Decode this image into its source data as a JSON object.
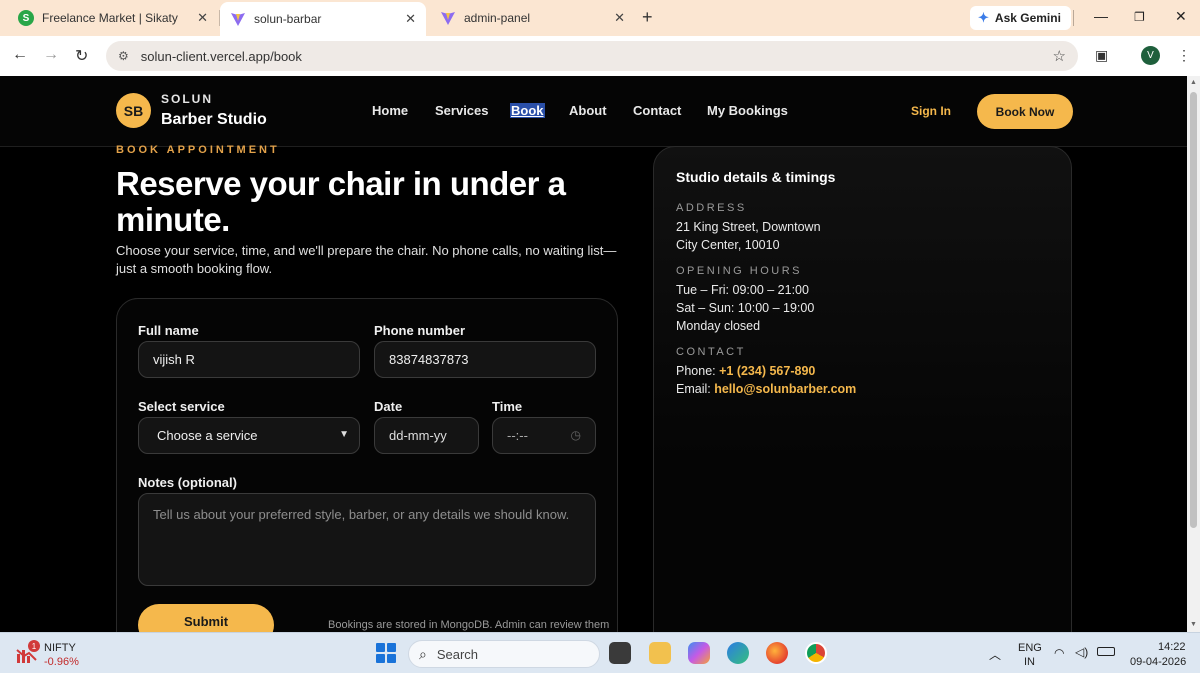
{
  "browser": {
    "tabs": [
      {
        "title": "Freelance Market | Sikaty",
        "active": false
      },
      {
        "title": "solun-barbar",
        "active": true
      },
      {
        "title": "admin-panel",
        "active": false
      }
    ],
    "gemini_label": "Ask Gemini",
    "url": "solun-client.vercel.app/book",
    "profile_initial": "V"
  },
  "site": {
    "logo_initials": "SB",
    "logo_top": "SOLUN",
    "logo_bottom": "Barber Studio",
    "nav": [
      "Home",
      "Services",
      "Book",
      "About",
      "Contact",
      "My Bookings"
    ],
    "current_nav": "Book",
    "sign_in": "Sign In",
    "book_now": "Book Now"
  },
  "hero": {
    "eyebrow": "BOOK APPOINTMENT",
    "headline": "Reserve your chair in under a minute.",
    "intro": "Choose your service, time, and we'll prepare the chair. No phone calls, no waiting list—just a smooth booking flow."
  },
  "form": {
    "full_name_label": "Full name",
    "full_name_value": "vijish R",
    "phone_label": "Phone number",
    "phone_value": "83874837873",
    "service_label": "Select service",
    "service_value": "Choose a service",
    "date_label": "Date",
    "date_placeholder": "dd-mm-yy",
    "time_label": "Time",
    "time_placeholder": "--:--",
    "notes_label": "Notes (optional)",
    "notes_placeholder": "Tell us about your preferred style, barber, or any details we should know.",
    "submit_label": "Submit",
    "storage_note": "Bookings are stored in MongoDB. Admin can review them"
  },
  "details": {
    "title": "Studio details & timings",
    "address_label": "ADDRESS",
    "address_line1": "21 King Street, Downtown",
    "address_line2": "City Center, 10010",
    "hours_label": "OPENING HOURS",
    "hours_line1": "Tue – Fri: 09:00 – 21:00",
    "hours_line2": "Sat – Sun: 10:00 – 19:00",
    "hours_line3": "Monday closed",
    "contact_label": "CONTACT",
    "phone_prefix": "Phone: ",
    "phone": "+1 (234) 567-890",
    "email_prefix": "Email: ",
    "email": "hello@solunbarber.com"
  },
  "taskbar": {
    "ticker_name": "NIFTY",
    "ticker_change": "-0.96%",
    "ticker_badge": "1",
    "search_placeholder": "Search",
    "lang_line1": "ENG",
    "lang_line2": "IN",
    "time": "14:22",
    "date": "09-04-2026"
  },
  "colors": {
    "accent": "#f5b84c",
    "background": "#000000",
    "nav_highlight": "#2a4fa8"
  }
}
